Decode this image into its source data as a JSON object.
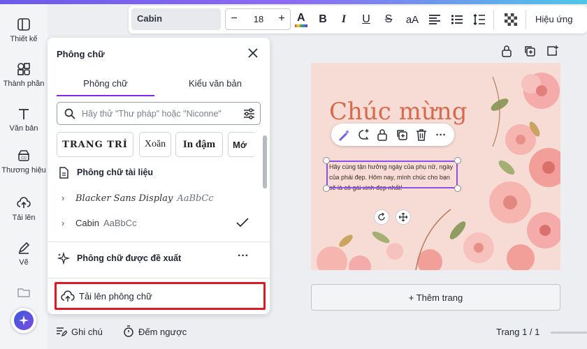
{
  "rail": {
    "items": [
      {
        "label": "Thiết kế",
        "icon": "layout-icon"
      },
      {
        "label": "Thành phần",
        "icon": "shapes-icon"
      },
      {
        "label": "Văn bản",
        "icon": "text-icon"
      },
      {
        "label": "Thương hiệu",
        "icon": "brand-icon"
      },
      {
        "label": "Tải lên",
        "icon": "cloud-upload-icon"
      },
      {
        "label": "Vẽ",
        "icon": "draw-icon"
      }
    ]
  },
  "toolbar": {
    "font_name": "Cabin",
    "size_minus": "−",
    "font_size": "18",
    "size_plus": "+",
    "color_letter": "A",
    "bold": "B",
    "italic": "I",
    "underline": "U",
    "strike": "S",
    "case": "aA",
    "effects_label": "Hiệu ứng"
  },
  "panel": {
    "title": "Phông chữ",
    "tabs": [
      {
        "label": "Phông chữ",
        "active": true
      },
      {
        "label": "Kiểu văn bản",
        "active": false
      }
    ],
    "search_placeholder": "Hãy thử \"Thư pháp\" hoặc \"Niconne\"",
    "chips": [
      "TRANG TRÍ",
      "Xoăn",
      "In đậm",
      "Mớ"
    ],
    "doc_fonts_heading": "Phông chữ tài liệu",
    "doc_fonts": [
      {
        "name": "Blacker Sans Display",
        "sample": "AaBbCc",
        "checked": false
      },
      {
        "name": "Cabin",
        "sample": "AaBbCc",
        "checked": true
      }
    ],
    "suggested_heading": "Phông chữ được đề xuất",
    "upload_label": "Tải lên phông chữ"
  },
  "design": {
    "title": "Chúc mừng",
    "body": "Hãy cùng tận hưởng ngày của phụ nữ, ngày của phái đẹp. Hôm nay, mình chúc cho bạn sẽ là cô gái xinh đẹp nhất!"
  },
  "add_page_label": "+ Thêm trang",
  "bottom": {
    "notes_label": "Ghi chú",
    "timer_label": "Đếm ngược",
    "page_indicator": "Trang 1 / 1"
  },
  "colors": {
    "accent": "#7d2ae8",
    "highlight_box": "#d81b27",
    "title_color": "#d56a4f",
    "page_bg": "#f7dcd5"
  }
}
